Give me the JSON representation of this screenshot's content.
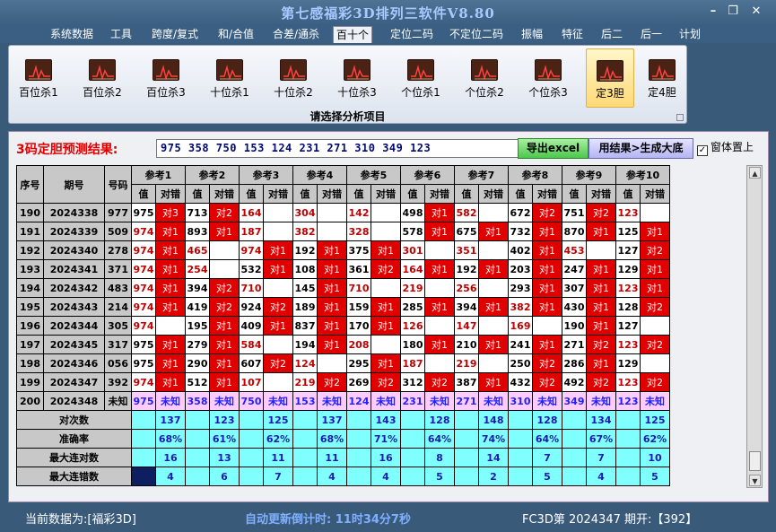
{
  "app": {
    "title": "第七感福彩3D排列三软件V8.80"
  },
  "menu": [
    "系统数据",
    "工具",
    "跨度/复式",
    "和/合值",
    "合差/通杀",
    "百十个",
    "定位二码",
    "不定位二码",
    "振幅",
    "特征",
    "后二",
    "后一",
    "计划"
  ],
  "menu_active": 5,
  "toolbar": {
    "buttons": [
      "百位杀1",
      "百位杀2",
      "百位杀3",
      "十位杀1",
      "十位杀2",
      "十位杀3",
      "个位杀1",
      "个位杀2",
      "个位杀3",
      "定3胆",
      "定4胆"
    ],
    "selected": 9,
    "caption": "请选择分析项目"
  },
  "prediction": {
    "label": "3码定胆预测结果:",
    "value": "975 358 750 153 124 231 271 310 349 123",
    "export_label": "导出excel",
    "generate_label": "用结果>生成大底",
    "ontop_label": "窗体置上",
    "ontop_checked": "✓"
  },
  "table": {
    "head_serial": "序号",
    "head_issue": "期号",
    "head_number": "号码",
    "refs": [
      "参考1",
      "参考2",
      "参考3",
      "参考4",
      "参考5",
      "参考6",
      "参考7",
      "参考8",
      "参考9",
      "参考10"
    ],
    "sub_value": "值",
    "sub_check": "对错",
    "rows": [
      {
        "serial": "190",
        "issue": "2024338",
        "number": "977",
        "refs": [
          [
            "975",
            "对3"
          ],
          [
            "713",
            "对2"
          ],
          [
            "164",
            ""
          ],
          [
            "304",
            ""
          ],
          [
            "142",
            ""
          ],
          [
            "498",
            "对1"
          ],
          [
            "582",
            ""
          ],
          [
            "672",
            "对2"
          ],
          [
            "751",
            "对2"
          ],
          [
            "123",
            ""
          ]
        ]
      },
      {
        "serial": "191",
        "issue": "2024339",
        "number": "509",
        "refs": [
          [
            "974",
            "对1"
          ],
          [
            "893",
            "对1"
          ],
          [
            "187",
            ""
          ],
          [
            "382",
            ""
          ],
          [
            "328",
            ""
          ],
          [
            "578",
            "对1"
          ],
          [
            "675",
            "对1"
          ],
          [
            "732",
            "对1"
          ],
          [
            "870",
            "对1"
          ],
          [
            "125",
            "对1"
          ]
        ]
      },
      {
        "serial": "192",
        "issue": "2024340",
        "number": "278",
        "refs": [
          [
            "974",
            "对1"
          ],
          [
            "465",
            ""
          ],
          [
            "974",
            "对1"
          ],
          [
            "192",
            "对1"
          ],
          [
            "375",
            "对1"
          ],
          [
            "301",
            ""
          ],
          [
            "351",
            ""
          ],
          [
            "402",
            "对1"
          ],
          [
            "453",
            ""
          ],
          [
            "127",
            "对2"
          ]
        ]
      },
      {
        "serial": "193",
        "issue": "2024341",
        "number": "371",
        "refs": [
          [
            "974",
            "对1"
          ],
          [
            "254",
            ""
          ],
          [
            "532",
            "对1"
          ],
          [
            "108",
            "对1"
          ],
          [
            "361",
            "对2"
          ],
          [
            "164",
            "对1"
          ],
          [
            "192",
            "对1"
          ],
          [
            "203",
            "对1"
          ],
          [
            "247",
            "对1"
          ],
          [
            "129",
            "对1"
          ]
        ]
      },
      {
        "serial": "194",
        "issue": "2024342",
        "number": "483",
        "refs": [
          [
            "974",
            "对1"
          ],
          [
            "394",
            "对2"
          ],
          [
            "710",
            ""
          ],
          [
            "145",
            "对1"
          ],
          [
            "710",
            ""
          ],
          [
            "219",
            ""
          ],
          [
            "256",
            ""
          ],
          [
            "293",
            "对1"
          ],
          [
            "307",
            "对1"
          ],
          [
            "123",
            "对1"
          ]
        ]
      },
      {
        "serial": "195",
        "issue": "2024343",
        "number": "214",
        "refs": [
          [
            "974",
            "对1"
          ],
          [
            "419",
            "对2"
          ],
          [
            "924",
            "对2"
          ],
          [
            "189",
            "对1"
          ],
          [
            "159",
            "对1"
          ],
          [
            "285",
            "对1"
          ],
          [
            "394",
            "对1"
          ],
          [
            "382",
            "对1"
          ],
          [
            "430",
            "对1"
          ],
          [
            "128",
            "对2"
          ]
        ]
      },
      {
        "serial": "196",
        "issue": "2024344",
        "number": "305",
        "refs": [
          [
            "974",
            ""
          ],
          [
            "195",
            "对1"
          ],
          [
            "409",
            "对1"
          ],
          [
            "837",
            "对1"
          ],
          [
            "170",
            "对1"
          ],
          [
            "126",
            ""
          ],
          [
            "147",
            ""
          ],
          [
            "169",
            ""
          ],
          [
            "190",
            "对1"
          ],
          [
            "127",
            ""
          ]
        ]
      },
      {
        "serial": "197",
        "issue": "2024345",
        "number": "317",
        "refs": [
          [
            "975",
            "对1"
          ],
          [
            "279",
            "对1"
          ],
          [
            "584",
            ""
          ],
          [
            "194",
            "对1"
          ],
          [
            "208",
            ""
          ],
          [
            "180",
            "对1"
          ],
          [
            "210",
            "对1"
          ],
          [
            "241",
            "对1"
          ],
          [
            "271",
            "对2"
          ],
          [
            "123",
            "对2"
          ]
        ]
      },
      {
        "serial": "198",
        "issue": "2024346",
        "number": "056",
        "refs": [
          [
            "975",
            "对1"
          ],
          [
            "290",
            "对1"
          ],
          [
            "607",
            "对2"
          ],
          [
            "124",
            ""
          ],
          [
            "295",
            "对1"
          ],
          [
            "187",
            ""
          ],
          [
            "219",
            ""
          ],
          [
            "250",
            "对2"
          ],
          [
            "286",
            "对1"
          ],
          [
            "129",
            ""
          ]
        ]
      },
      {
        "serial": "199",
        "issue": "2024347",
        "number": "392",
        "refs": [
          [
            "974",
            "对1"
          ],
          [
            "512",
            "对1"
          ],
          [
            "107",
            ""
          ],
          [
            "219",
            "对2"
          ],
          [
            "269",
            "对2"
          ],
          [
            "312",
            "对2"
          ],
          [
            "387",
            "对1"
          ],
          [
            "432",
            "对2"
          ],
          [
            "492",
            "对2"
          ],
          [
            "123",
            "对2"
          ]
        ]
      }
    ],
    "pred_row": {
      "serial": "200",
      "issue": "2024348",
      "number": "未知",
      "values": [
        "975",
        "358",
        "750",
        "153",
        "124",
        "231",
        "271",
        "310",
        "349",
        "123"
      ],
      "check": "未知"
    },
    "stats": [
      {
        "label": "对次数",
        "values": [
          "137",
          "123",
          "125",
          "137",
          "143",
          "128",
          "148",
          "128",
          "134",
          "125"
        ]
      },
      {
        "label": "准确率",
        "values": [
          "68%",
          "61%",
          "62%",
          "68%",
          "71%",
          "64%",
          "74%",
          "64%",
          "67%",
          "62%"
        ]
      },
      {
        "label": "最大连对数",
        "values": [
          "16",
          "13",
          "11",
          "11",
          "16",
          "8",
          "14",
          "7",
          "7",
          "10"
        ]
      },
      {
        "label": "最大连错数",
        "values": [
          "4",
          "6",
          "7",
          "4",
          "4",
          "5",
          "2",
          "5",
          "4",
          "5"
        ]
      }
    ],
    "red_values": [
      "164",
      "304",
      "142",
      "582",
      "123",
      "187",
      "382",
      "328",
      "465",
      "301",
      "351",
      "453",
      "254",
      "710",
      "219",
      "256",
      "974",
      "126",
      "147",
      "169",
      "584",
      "208",
      "124",
      "107"
    ]
  },
  "status": {
    "current": "当前数据为:[福彩3D]",
    "countdown": "自动更新倒计时:  11时34分7秒",
    "latest": "FC3D第 2024347 期开:【392】"
  }
}
